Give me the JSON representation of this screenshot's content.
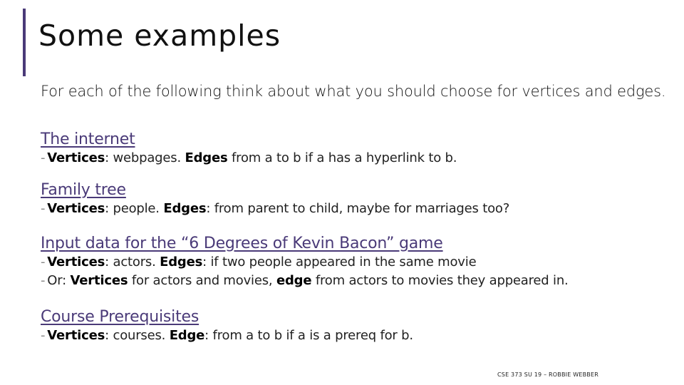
{
  "slide": {
    "title": "Some examples",
    "intro": "For each of the following think about what you should choose for vertices and edges.",
    "accent_color": "#4a3a78",
    "sections": [
      {
        "heading": "The internet",
        "bullets": [
          [
            {
              "t": "Vertices",
              "b": true
            },
            {
              "t": ": webpages. ",
              "b": false
            },
            {
              "t": "Edges",
              "b": true
            },
            {
              "t": " from a to b if a has a hyperlink to b.",
              "b": false
            }
          ]
        ]
      },
      {
        "heading": "Family tree",
        "bullets": [
          [
            {
              "t": "Vertices",
              "b": true
            },
            {
              "t": ": people. ",
              "b": false
            },
            {
              "t": "Edges",
              "b": true
            },
            {
              "t": ": from parent to child, maybe for marriages too?",
              "b": false
            }
          ]
        ]
      },
      {
        "heading": "Input data for the “6 Degrees of Kevin Bacon” game",
        "bullets": [
          [
            {
              "t": "Vertices",
              "b": true
            },
            {
              "t": ": actors. ",
              "b": false
            },
            {
              "t": "Edges",
              "b": true
            },
            {
              "t": ": if two people appeared in the same movie",
              "b": false
            }
          ],
          [
            {
              "t": "Or: ",
              "b": false
            },
            {
              "t": "Vertices",
              "b": true
            },
            {
              "t": " for actors and movies, ",
              "b": false
            },
            {
              "t": "edge",
              "b": true
            },
            {
              "t": " from actors to movies they appeared in.",
              "b": false
            }
          ]
        ]
      },
      {
        "heading": "Course Prerequisites",
        "bullets": [
          [
            {
              "t": "Vertices",
              "b": true
            },
            {
              "t": ": courses. ",
              "b": false
            },
            {
              "t": "Edge",
              "b": true
            },
            {
              "t": ": from a to b if a is a prereq for b.",
              "b": false
            }
          ]
        ]
      }
    ],
    "bullet_marker": "-",
    "footer": "CSE 373 SU 19 – ROBBIE WEBBER"
  }
}
